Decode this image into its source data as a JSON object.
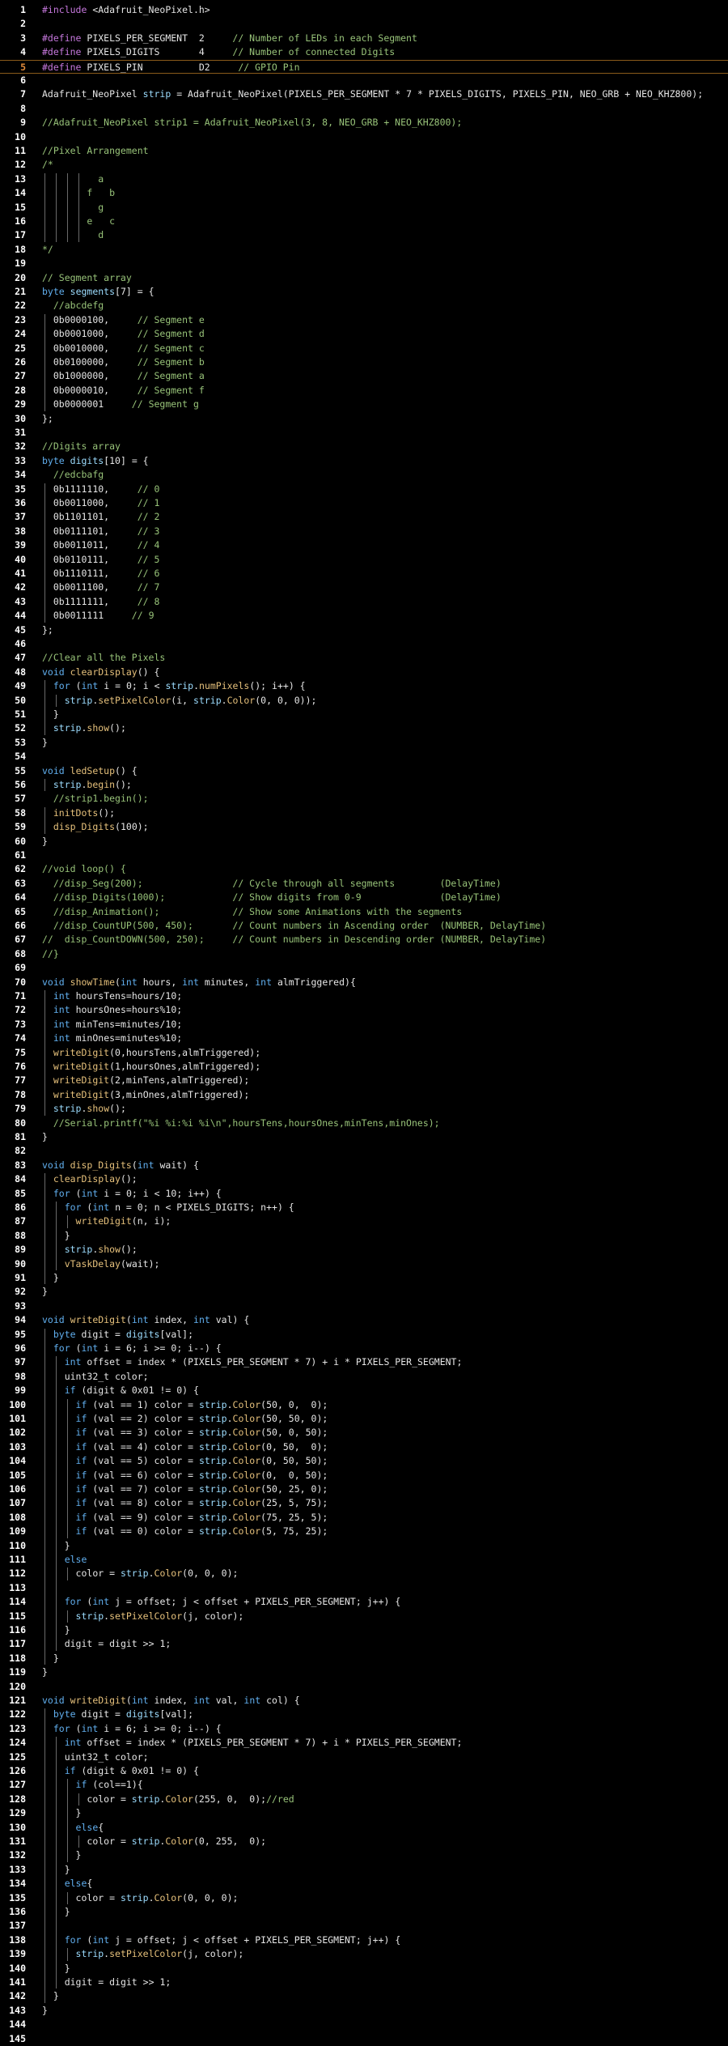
{
  "colors": {
    "background": "#000000",
    "plain": "#e6e6e6",
    "keyword": "#c678dd",
    "type": "#61afef",
    "function": "#e5c07b",
    "comment": "#98c379",
    "variable": "#9cdcfe",
    "number": "#d19a66",
    "preprocessor": "#c678dd",
    "line_number": "#ffffff",
    "current_line_number": "#e08a3a"
  },
  "editor": {
    "current_line": 5,
    "lines": [
      "#include <Adafruit_NeoPixel.h>",
      "",
      "#define PIXELS_PER_SEGMENT  2     // Number of LEDs in each Segment",
      "#define PIXELS_DIGITS       4     // Number of connected Digits",
      "#define PIXELS_PIN          D2     // GPIO Pin",
      "",
      "Adafruit_NeoPixel strip = Adafruit_NeoPixel(PIXELS_PER_SEGMENT * 7 * PIXELS_DIGITS, PIXELS_PIN, NEO_GRB + NEO_KHZ800);",
      "",
      "//Adafruit_NeoPixel strip1 = Adafruit_NeoPixel(3, 8, NEO_GRB + NEO_KHZ800);",
      "",
      "//Pixel Arrangement",
      "/*",
      "          a",
      "        f   b",
      "          g",
      "        e   c",
      "          d",
      "*/",
      "",
      "// Segment array",
      "byte segments[7] = {",
      "  //abcdefg",
      "  0b0000100,     // Segment e",
      "  0b0001000,     // Segment d",
      "  0b0010000,     // Segment c",
      "  0b0100000,     // Segment b",
      "  0b1000000,     // Segment a",
      "  0b0000010,     // Segment f",
      "  0b0000001     // Segment g",
      "};",
      "",
      "//Digits array",
      "byte digits[10] = {",
      "  //edcbafg",
      "  0b1111110,     // 0",
      "  0b0011000,     // 1",
      "  0b1101101,     // 2",
      "  0b0111101,     // 3",
      "  0b0011011,     // 4",
      "  0b0110111,     // 5",
      "  0b1110111,     // 6",
      "  0b0011100,     // 7",
      "  0b1111111,     // 8",
      "  0b0011111     // 9",
      "};",
      "",
      "//Clear all the Pixels",
      "void clearDisplay() {",
      "  for (int i = 0; i < strip.numPixels(); i++) {",
      "    strip.setPixelColor(i, strip.Color(0, 0, 0));",
      "  }",
      "  strip.show();",
      "}",
      "",
      "void ledSetup() {",
      "  strip.begin();",
      "  //strip1.begin();",
      "  initDots();",
      "  disp_Digits(100);",
      "}",
      "",
      "//void loop() {",
      "  //disp_Seg(200);                // Cycle through all segments        (DelayTime)",
      "  //disp_Digits(1000);            // Show digits from 0-9              (DelayTime)",
      "  //disp_Animation();             // Show some Animations with the segments",
      "  //disp_CountUP(500, 450);       // Count numbers in Ascending order  (NUMBER, DelayTime)",
      "//  disp_CountDOWN(500, 250);     // Count numbers in Descending order (NUMBER, DelayTime)",
      "//}",
      "",
      "void showTime(int hours, int minutes, int almTriggered){",
      "  int hoursTens=hours/10;",
      "  int hoursOnes=hours%10;",
      "  int minTens=minutes/10;",
      "  int minOnes=minutes%10;",
      "  writeDigit(0,hoursTens,almTriggered);",
      "  writeDigit(1,hoursOnes,almTriggered);",
      "  writeDigit(2,minTens,almTriggered);",
      "  writeDigit(3,minOnes,almTriggered);",
      "  strip.show();",
      "  //Serial.printf(\"%i %i:%i %i\\n\",hoursTens,hoursOnes,minTens,minOnes);",
      "}",
      "",
      "void disp_Digits(int wait) {",
      "  clearDisplay();",
      "  for (int i = 0; i < 10; i++) {",
      "    for (int n = 0; n < PIXELS_DIGITS; n++) {",
      "      writeDigit(n, i);",
      "    }",
      "    strip.show();",
      "    vTaskDelay(wait);",
      "  }",
      "}",
      "",
      "void writeDigit(int index, int val) {",
      "  byte digit = digits[val];",
      "  for (int i = 6; i >= 0; i--) {",
      "    int offset = index * (PIXELS_PER_SEGMENT * 7) + i * PIXELS_PER_SEGMENT;",
      "    uint32_t color;",
      "    if (digit & 0x01 != 0) {",
      "      if (val == 1) color = strip.Color(50, 0,  0);",
      "      if (val == 2) color = strip.Color(50, 50, 0);",
      "      if (val == 3) color = strip.Color(50, 0, 50);",
      "      if (val == 4) color = strip.Color(0, 50,  0);",
      "      if (val == 5) color = strip.Color(0, 50, 50);",
      "      if (val == 6) color = strip.Color(0,  0, 50);",
      "      if (val == 7) color = strip.Color(50, 25, 0);",
      "      if (val == 8) color = strip.Color(25, 5, 75);",
      "      if (val == 9) color = strip.Color(75, 25, 5);",
      "      if (val == 0) color = strip.Color(5, 75, 25);",
      "    }",
      "    else",
      "      color = strip.Color(0, 0, 0);",
      "",
      "    for (int j = offset; j < offset + PIXELS_PER_SEGMENT; j++) {",
      "      strip.setPixelColor(j, color);",
      "    }",
      "    digit = digit >> 1;",
      "  }",
      "}",
      "",
      "void writeDigit(int index, int val, int col) {",
      "  byte digit = digits[val];",
      "  for (int i = 6; i >= 0; i--) {",
      "    int offset = index * (PIXELS_PER_SEGMENT * 7) + i * PIXELS_PER_SEGMENT;",
      "    uint32_t color;",
      "    if (digit & 0x01 != 0) {",
      "      if (col==1){",
      "        color = strip.Color(255, 0,  0);//red",
      "      }",
      "      else{",
      "        color = strip.Color(0, 255,  0);",
      "      }",
      "    }",
      "    else{",
      "      color = strip.Color(0, 0, 0);",
      "    }",
      "",
      "    for (int j = offset; j < offset + PIXELS_PER_SEGMENT; j++) {",
      "      strip.setPixelColor(j, color);",
      "    }",
      "    digit = digit >> 1;",
      "  }",
      "}",
      "",
      ""
    ]
  }
}
